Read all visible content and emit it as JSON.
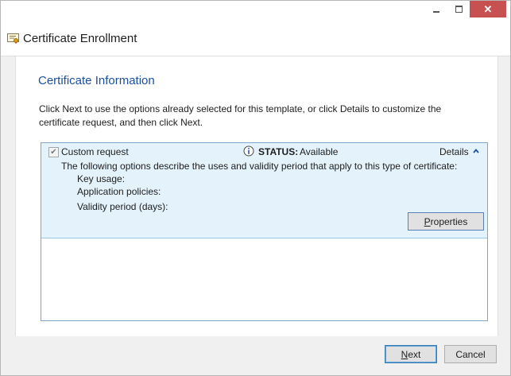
{
  "window": {
    "title": "Certificate Enrollment"
  },
  "page": {
    "heading": "Certificate Information",
    "instructions": "Click Next to use the options already selected for this template, or click Details to customize the certificate request, and then click Next."
  },
  "request": {
    "checked": true,
    "name": "Custom request",
    "status_label": "STATUS:",
    "status_value": "Available",
    "details_label": "Details",
    "description": "The following options describe the uses and validity period that apply to this type of certificate:",
    "fields": [
      "Key usage:",
      "Application policies:",
      "Validity period (days):"
    ],
    "properties_button": {
      "label_prefix": "",
      "accel": "P",
      "label_rest": "roperties"
    }
  },
  "footer": {
    "next_button": {
      "accel": "N",
      "label_rest": "ext"
    },
    "cancel_button": "Cancel"
  },
  "colors": {
    "heading": "#1b4fa3",
    "item_background": "#e3f2fb",
    "close_button": "#c75050"
  }
}
